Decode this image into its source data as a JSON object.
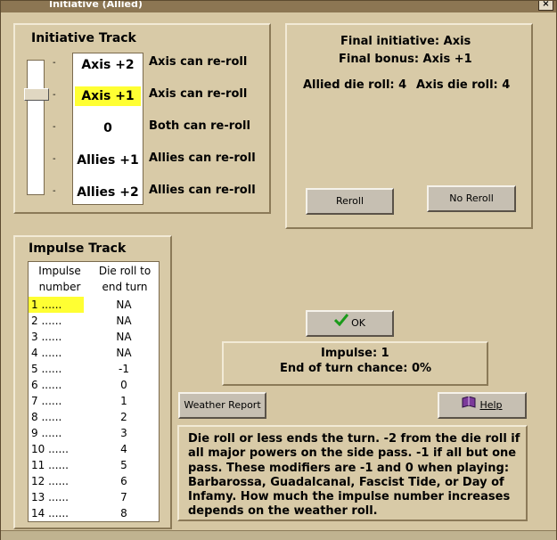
{
  "window": {
    "title": "Initiative (Allied)",
    "close_glyph": "×"
  },
  "initiative_track": {
    "title": "Initiative Track",
    "rows": [
      {
        "value": "Axis +2",
        "desc": "Axis can re-roll",
        "selected": false
      },
      {
        "value": "Axis +1",
        "desc": "Axis can re-roll",
        "selected": true
      },
      {
        "value": "0",
        "desc": "Both can re-roll",
        "selected": false
      },
      {
        "value": "Allies +1",
        "desc": "Allies can re-roll",
        "selected": false
      },
      {
        "value": "Allies +2",
        "desc": "Allies can re-roll",
        "selected": false
      }
    ],
    "tick_mark": "-"
  },
  "final_info": {
    "final_initiative": "Final initiative: Axis",
    "final_bonus": "Final bonus: Axis +1",
    "allied_roll": "Allied die roll: 4",
    "axis_roll": "Axis die roll: 4"
  },
  "buttons": {
    "reroll": "Reroll",
    "no_reroll": "No Reroll",
    "ok": "OK",
    "weather_report": "Weather Report",
    "help": "Help"
  },
  "impulse_track": {
    "title": "Impulse Track",
    "col1_line1": "Impulse",
    "col1_line2": "number",
    "col2_line1": "Die roll to",
    "col2_line2": "end turn",
    "rows": [
      {
        "num": "1 ......",
        "val": "NA",
        "selected": true
      },
      {
        "num": "2 ......",
        "val": "NA",
        "selected": false
      },
      {
        "num": "3 ......",
        "val": "NA",
        "selected": false
      },
      {
        "num": "4 ......",
        "val": "NA",
        "selected": false
      },
      {
        "num": "5 ......",
        "val": "-1",
        "selected": false
      },
      {
        "num": "6 ......",
        "val": "0",
        "selected": false
      },
      {
        "num": "7 ......",
        "val": "1",
        "selected": false
      },
      {
        "num": "8 ......",
        "val": "2",
        "selected": false
      },
      {
        "num": "9 ......",
        "val": "3",
        "selected": false
      },
      {
        "num": "10 ......",
        "val": "4",
        "selected": false
      },
      {
        "num": "11 ......",
        "val": "5",
        "selected": false
      },
      {
        "num": "12 ......",
        "val": "6",
        "selected": false
      },
      {
        "num": "13 ......",
        "val": "7",
        "selected": false
      },
      {
        "num": "14 ......",
        "val": "8",
        "selected": false
      }
    ]
  },
  "impulse_status": {
    "impulse": "Impulse: 1",
    "end_chance": "End of turn chance: 0%"
  },
  "note": {
    "line1": "Die roll or less ends the turn.  -2 from the die roll if",
    "line2": "all major powers on the side pass.  -1 if all but one",
    "line3": "pass.  These modifiers are -1 and 0 when playing:",
    "line4": "Barbarossa, Guadalcanal, Fascist Tide, or Day of",
    "line5": "Infamy.  How much the impulse number increases",
    "line6": "depends on the weather roll."
  },
  "icons": {
    "ok": "checkmark-icon",
    "help": "help-book-icon"
  },
  "colors": {
    "highlight": "#ffff33",
    "panel": "#d8caa7",
    "ok_check": "#1a9a1a"
  }
}
